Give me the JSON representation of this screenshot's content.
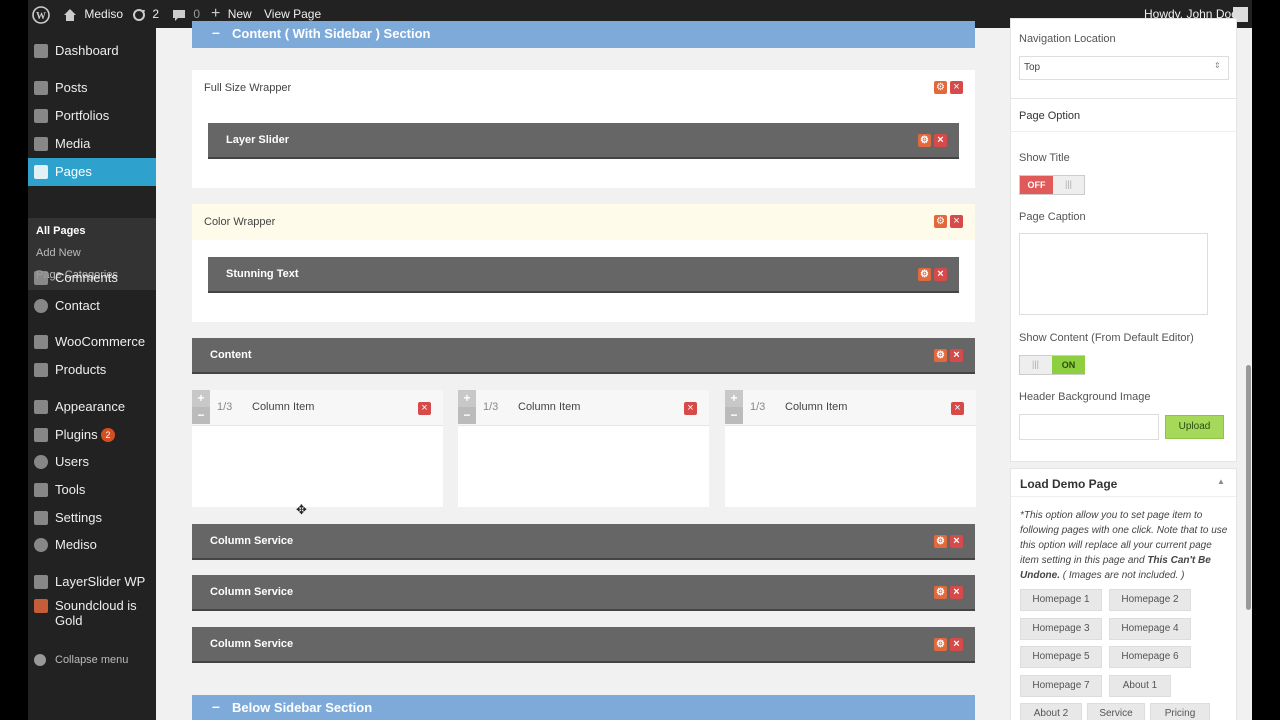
{
  "admin_bar": {
    "site_name": "Mediso",
    "updates_count": "2",
    "comments_count": "0",
    "new_label": "New",
    "view_page_label": "View Page",
    "howdy": "Howdy, John Doe"
  },
  "menu": {
    "items": [
      {
        "label": "Dashboard",
        "icon": "dashboard-icon"
      },
      {
        "label": "Posts",
        "icon": "pin-icon"
      },
      {
        "label": "Portfolios",
        "icon": "pin-icon"
      },
      {
        "label": "Media",
        "icon": "media-icon"
      },
      {
        "label": "Pages",
        "icon": "pages-icon"
      },
      {
        "label": "Comments",
        "icon": "comment-icon"
      },
      {
        "label": "Contact",
        "icon": "gear-icon"
      },
      {
        "label": "WooCommerce",
        "icon": "woo-icon"
      },
      {
        "label": "Products",
        "icon": "cart-icon"
      },
      {
        "label": "Appearance",
        "icon": "brush-icon"
      },
      {
        "label": "Plugins",
        "icon": "plug-icon",
        "badge": "2"
      },
      {
        "label": "Users",
        "icon": "user-icon"
      },
      {
        "label": "Tools",
        "icon": "wrench-icon"
      },
      {
        "label": "Settings",
        "icon": "settings-icon"
      },
      {
        "label": "Mediso",
        "icon": "gear-icon"
      },
      {
        "label": "LayerSlider WP",
        "icon": "layers-icon"
      },
      {
        "label": "Soundcloud is Gold",
        "icon": "soundcloud-icon"
      }
    ],
    "submenu": [
      "All Pages",
      "Add New",
      "Page Categories"
    ],
    "collapse": "Collapse menu"
  },
  "builder": {
    "top_section": "Content ( With Sidebar ) Section",
    "full_wrapper": "Full Size Wrapper",
    "layer_slider": "Layer Slider",
    "color_wrapper": "Color Wrapper",
    "stunning_text": "Stunning Text",
    "content": "Content",
    "columns": [
      {
        "fraction": "1/3",
        "title": "Column Item"
      },
      {
        "fraction": "1/3",
        "title": "Column Item"
      },
      {
        "fraction": "1/3",
        "title": "Column Item"
      }
    ],
    "services": [
      "Column Service",
      "Column Service",
      "Column Service"
    ],
    "bottom_section": "Below Sidebar Section",
    "minus": "–"
  },
  "right": {
    "nav_location_label": "Navigation Location",
    "nav_location_value": "Top",
    "page_option_title": "Page Option",
    "show_title_label": "Show Title",
    "show_title_state": "OFF",
    "page_caption_label": "Page Caption",
    "show_content_label": "Show Content (From Default Editor)",
    "show_content_state": "ON",
    "header_bg_label": "Header Background Image",
    "upload_label": "Upload",
    "demo_title": "Load Demo Page",
    "demo_desc_1": "*This option allow you to set page item to following pages with one click. Note that to use this option will replace all your current page item setting in this page and ",
    "demo_desc_bold": "This Can't Be Undone.",
    "demo_desc_2": " ( Images are not included. )",
    "demo_buttons": [
      "Homepage 1",
      "Homepage 2",
      "Homepage 3",
      "Homepage 4",
      "Homepage 5",
      "Homepage 6",
      "Homepage 7",
      "About 1",
      "About 2",
      "Service",
      "Pricing"
    ]
  }
}
